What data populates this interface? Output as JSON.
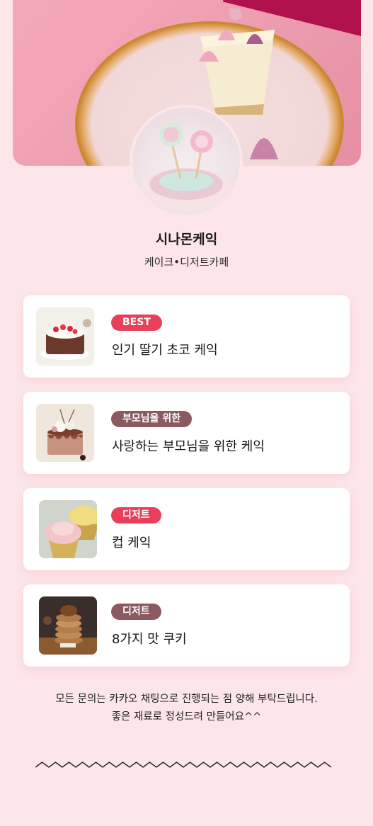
{
  "shop": {
    "name": "시나몬케익",
    "category": "케이크•디저트카페"
  },
  "colors": {
    "background": "#fde6ea",
    "badge_red": "#e8405a",
    "badge_brown": "#8a5a60"
  },
  "items": [
    {
      "badge": "BEST",
      "badge_color": "red",
      "title": "인기 딸기 초코 케익",
      "thumb_icon": "strawberry-chocolate-cake"
    },
    {
      "badge": "부모님을 위한",
      "badge_color": "brown",
      "title": "사랑하는 부모님을 위한 케익",
      "thumb_icon": "flower-drip-cake"
    },
    {
      "badge": "디저트",
      "badge_color": "red",
      "title": "컵 케익",
      "thumb_icon": "cupcake"
    },
    {
      "badge": "디저트",
      "badge_color": "brown",
      "title": "8가지 맛 쿠키",
      "thumb_icon": "cookie-stack"
    }
  ],
  "notice": {
    "line1": "모든 문의는 카카오 채팅으로 진행되는 점 양해 부탁드립니다.",
    "line2": "좋은 재료로 정성드려 만들어요^^"
  }
}
